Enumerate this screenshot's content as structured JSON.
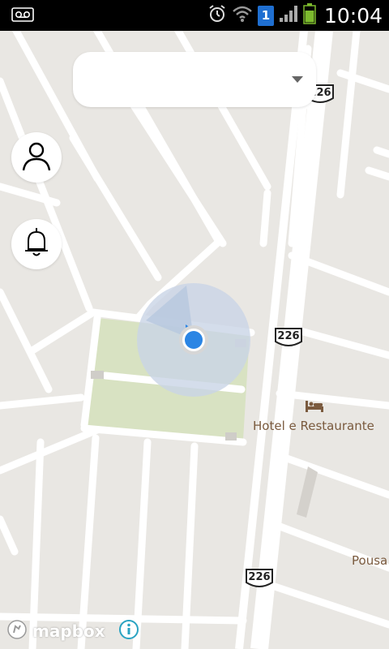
{
  "status_bar": {
    "time": "10:04",
    "sim_slot": "1",
    "icons": [
      "voicemail-icon",
      "alarm-icon",
      "wifi-icon",
      "sim-icon",
      "signal-icon",
      "battery-icon"
    ]
  },
  "top_selector": {
    "value": "",
    "caret_icon": "dropdown-caret-icon"
  },
  "buttons": {
    "profile_icon": "person-icon",
    "notifications_icon": "bell-icon"
  },
  "map": {
    "route_shields": [
      "226",
      "226",
      "226"
    ],
    "pois": [
      {
        "label": "Hotel e Restaurante",
        "icon": "bed-icon"
      },
      {
        "label": "Pousa",
        "icon": ""
      }
    ],
    "location_marker_icon": "current-location-icon",
    "colors": {
      "background": "#e9e7e3",
      "road": "#ffffff",
      "park": "#d8e2c2",
      "accuracy": "#c9d5e6",
      "location_dot": "#2b85e4"
    }
  },
  "attribution": {
    "brand": "mapbox",
    "info_icon": "info-icon"
  }
}
